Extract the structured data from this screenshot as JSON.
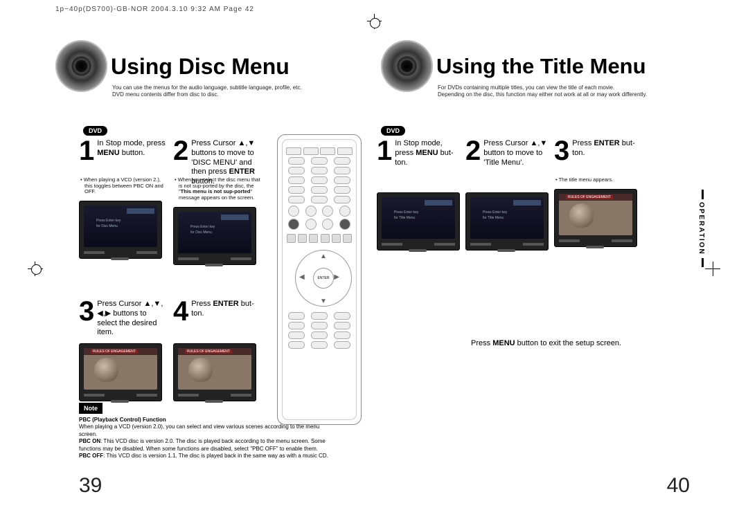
{
  "header": "1p~40p(DS700)-GB-NOR  2004.3.10  9:32 AM  Page 42",
  "badge_dvd": "DVD",
  "left": {
    "title": "Using Disc Menu",
    "subtitle": "You can use the menus for the audio language, subtitle language, profile, etc.\nDVD menu contents differ from disc to disc.",
    "step1": {
      "num": "1",
      "text_a": "In Stop mode, press ",
      "text_b": "MENU",
      "text_c": " button."
    },
    "step1_note": "When playing a VCD (version 2.), this toggles between PBC ON and OFF.",
    "step2": {
      "num": "2",
      "text_a": "Press Cursor ▲,▼ buttons to move to 'DISC MENU' and then press ",
      "text_b": "ENTER",
      "text_c": " button."
    },
    "step2_note1": "When you select the disc menu that is not sup-ported by the disc, the \"",
    "step2_note2": "This menu is not sup-ported",
    "step2_note3": "\" message appears on the screen.",
    "step3": {
      "num": "3",
      "text": "Press Cursor ▲,▼, ◀,▶ buttons to select the desired item."
    },
    "step4": {
      "num": "4",
      "text_a": "Press ",
      "text_b": "ENTER",
      "text_c": " but-ton."
    },
    "screen_text1": "Press Enter key\nfor Disc Menu",
    "screen_label": "DISC MENU",
    "note_label": "Note",
    "note_title": "PBC (Playback Control) Function",
    "note_line1": "When playing a VCD (version 2.0), you can select and view various scenes according to the menu screen.",
    "note_pbcon_l": "PBC ON",
    "note_pbcon": ": This VCD disc is version 2.0. The disc is played back according to the menu screen. Some functions may be disabled. When some functions are disabled, select \"PBC OFF\" to enable them.",
    "note_pbcoff_l": "PBC OFF",
    "note_pbcoff": ": This VCD disc is version 1.1. The disc is played back in the same way as with a music CD.",
    "page_num": "39"
  },
  "right": {
    "title": "Using the Title Menu",
    "subtitle": "For DVDs containing multiple titles, you can view the title of each movie.\nDepending on the disc, this function may either not work at all or may work differently.",
    "step1": {
      "num": "1",
      "text_a": "In Stop mode, press ",
      "text_b": "MENU",
      "text_c": " but-ton."
    },
    "step2": {
      "num": "2",
      "text": "Press Cursor ▲,▼ button to move to 'Title Menu'."
    },
    "step3": {
      "num": "3",
      "text_a": "Press ",
      "text_b": "ENTER",
      "text_c": " but-ton."
    },
    "step3_note": "The title menu appears.",
    "screen_text1": "Press Enter key\nfor Title Menu",
    "exit_a": "Press ",
    "exit_b": "MENU",
    "exit_c": " button to exit the setup screen.",
    "tab": "OPERATION",
    "page_num": "40",
    "video_label": "RULES OF ENGAGEMENT"
  },
  "remote_center": "ENTER"
}
